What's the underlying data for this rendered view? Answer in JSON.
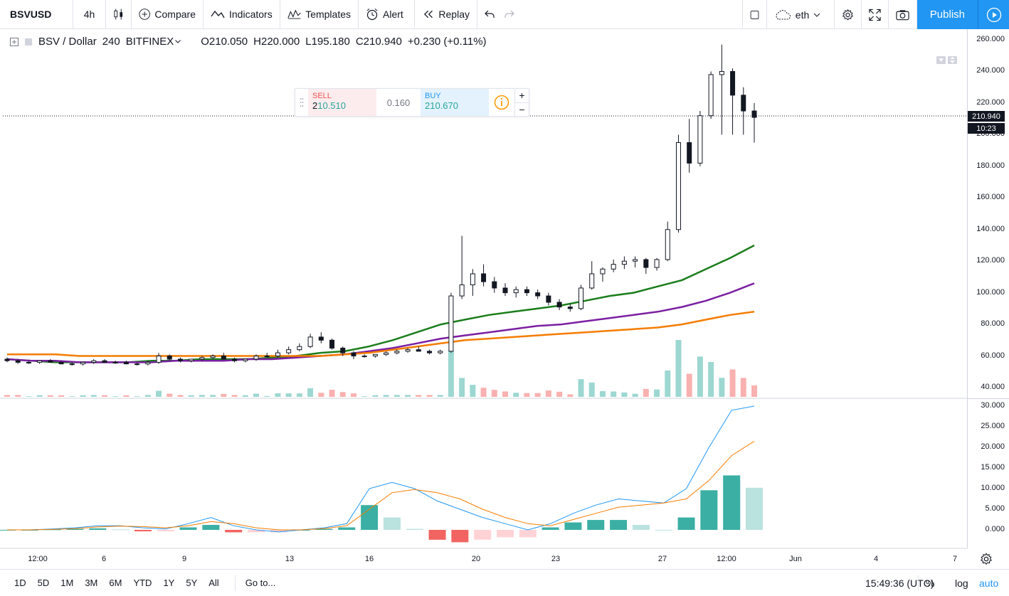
{
  "toolbar": {
    "symbol": "BSVUSD",
    "interval": "4h",
    "compare": "Compare",
    "indicators": "Indicators",
    "templates": "Templates",
    "alert": "Alert",
    "replay": "Replay",
    "layout_name": "eth",
    "publish": "Publish"
  },
  "legend": {
    "title": "BSV / Dollar",
    "interval": "240",
    "exchange": "BITFINEX",
    "open_label": "O",
    "open": "210.050",
    "high_label": "H",
    "high": "220.000",
    "low_label": "L",
    "low": "195.180",
    "close_label": "C",
    "close": "210.940",
    "change": "+0.230 (+0.11%)"
  },
  "trade_panel": {
    "sell_label": "SELL",
    "sell_prefix": "2",
    "sell_price": "10.510",
    "spread": "0.160",
    "buy_label": "BUY",
    "buy_price": "210.670"
  },
  "price_axis": {
    "ticks": [
      "260.000",
      "240.000",
      "220.000",
      "200.000",
      "180.000",
      "160.000",
      "140.000",
      "120.000",
      "100.000",
      "80.000",
      "60.000",
      "40.000"
    ],
    "last_price": "210.940",
    "countdown": "10:23"
  },
  "macd_axis": {
    "ticks": [
      "30.000",
      "25.000",
      "20.000",
      "15.000",
      "10.000",
      "5.000",
      "0.000"
    ]
  },
  "time_axis": {
    "ticks": [
      "12:00",
      "6",
      "9",
      "13",
      "16",
      "20",
      "23",
      "27",
      "12:00",
      "Jun",
      "4",
      "7"
    ]
  },
  "bottom": {
    "ranges": [
      "1D",
      "5D",
      "1M",
      "3M",
      "6M",
      "YTD",
      "1Y",
      "5Y",
      "All"
    ],
    "goto": "Go to...",
    "clock": "15:49:36 (UTC)",
    "percent": "%",
    "log": "log",
    "auto": "auto"
  },
  "colors": {
    "up": "#26a69a",
    "down": "#ef5350",
    "accent": "#2196f3",
    "ma_fast": "#1b7d1b",
    "ma_mid": "#7b1fa2",
    "ma_slow": "#f57c00"
  },
  "chart_data": {
    "type": "candlestick",
    "symbol": "BSV / Dollar",
    "y_range": [
      35,
      265
    ],
    "last_close": 210.94,
    "series": [
      {
        "kind": "ohlc",
        "values": [
          [
            58,
            59,
            56,
            57
          ],
          [
            57,
            58,
            55,
            56
          ],
          [
            56,
            57,
            55,
            56
          ],
          [
            56,
            57,
            55,
            57
          ],
          [
            57,
            58,
            56,
            56
          ],
          [
            56,
            57,
            55,
            55
          ],
          [
            55,
            56,
            54,
            55
          ],
          [
            55,
            56,
            54,
            56
          ],
          [
            56,
            58,
            55,
            57
          ],
          [
            57,
            58,
            56,
            56
          ],
          [
            56,
            57,
            55,
            56
          ],
          [
            56,
            57,
            55,
            55
          ],
          [
            55,
            56,
            54,
            55
          ],
          [
            55,
            57,
            54,
            56
          ],
          [
            56,
            62,
            55,
            60
          ],
          [
            60,
            61,
            57,
            58
          ],
          [
            58,
            59,
            56,
            57
          ],
          [
            57,
            58,
            56,
            58
          ],
          [
            58,
            60,
            57,
            59
          ],
          [
            59,
            61,
            58,
            60
          ],
          [
            60,
            62,
            59,
            58
          ],
          [
            58,
            59,
            56,
            57
          ],
          [
            57,
            58,
            56,
            58
          ],
          [
            58,
            61,
            57,
            60
          ],
          [
            60,
            62,
            59,
            60
          ],
          [
            60,
            64,
            59,
            62
          ],
          [
            62,
            66,
            61,
            64
          ],
          [
            64,
            68,
            63,
            66
          ],
          [
            66,
            74,
            65,
            72
          ],
          [
            72,
            75,
            68,
            70
          ],
          [
            70,
            71,
            64,
            65
          ],
          [
            65,
            66,
            60,
            62
          ],
          [
            62,
            63,
            58,
            60
          ],
          [
            60,
            61,
            59,
            60
          ],
          [
            60,
            61,
            59,
            61
          ],
          [
            61,
            63,
            60,
            62
          ],
          [
            62,
            64,
            61,
            63
          ],
          [
            63,
            65,
            62,
            64
          ],
          [
            64,
            66,
            63,
            63
          ],
          [
            63,
            64,
            61,
            62
          ],
          [
            62,
            64,
            61,
            63
          ],
          [
            63,
            100,
            62,
            98
          ],
          [
            98,
            136,
            96,
            105
          ],
          [
            105,
            115,
            98,
            112
          ],
          [
            112,
            118,
            104,
            107
          ],
          [
            107,
            110,
            100,
            103
          ],
          [
            103,
            106,
            98,
            100
          ],
          [
            100,
            104,
            97,
            102
          ],
          [
            102,
            104,
            98,
            100
          ],
          [
            100,
            102,
            96,
            98
          ],
          [
            98,
            100,
            92,
            94
          ],
          [
            94,
            96,
            89,
            91
          ],
          [
            91,
            93,
            88,
            90
          ],
          [
            90,
            105,
            89,
            103
          ],
          [
            103,
            120,
            102,
            112
          ],
          [
            112,
            116,
            107,
            115
          ],
          [
            115,
            121,
            113,
            118
          ],
          [
            118,
            123,
            115,
            120
          ],
          [
            120,
            123,
            116,
            121
          ],
          [
            121,
            122,
            112,
            116
          ],
          [
            116,
            122,
            114,
            121
          ],
          [
            121,
            145,
            120,
            140
          ],
          [
            140,
            200,
            138,
            195
          ],
          [
            195,
            210,
            176,
            182
          ],
          [
            182,
            215,
            180,
            212
          ],
          [
            212,
            240,
            210,
            238
          ],
          [
            238,
            257,
            200,
            240
          ],
          [
            240,
            242,
            200,
            225
          ],
          [
            225,
            230,
            200,
            215
          ],
          [
            215,
            220,
            195,
            210.94
          ]
        ]
      },
      {
        "kind": "ma",
        "name": "",
        "color": "#1b7d1b",
        "values": [
          58,
          57,
          56,
          56,
          56,
          56,
          57,
          57,
          58,
          58,
          58,
          59,
          60,
          62,
          63,
          66,
          70,
          75,
          80,
          83,
          86,
          88,
          90,
          92,
          95,
          98,
          100,
          104,
          108,
          115,
          122,
          130
        ]
      },
      {
        "kind": "ma",
        "name": "",
        "color": "#7b1fa2",
        "values": [
          58,
          57,
          57,
          56,
          56,
          56,
          56,
          57,
          57,
          57,
          58,
          58,
          59,
          60,
          61,
          63,
          65,
          68,
          71,
          73,
          75,
          77,
          79,
          80,
          82,
          84,
          86,
          88,
          91,
          95,
          100,
          106
        ]
      },
      {
        "kind": "ma",
        "name": "",
        "color": "#f57c00",
        "values": [
          61,
          61,
          61,
          60,
          60,
          60,
          60,
          60,
          60,
          60,
          60,
          60,
          60,
          60,
          61,
          62,
          64,
          66,
          68,
          70,
          71,
          72,
          73,
          74,
          75,
          76,
          77,
          78,
          80,
          83,
          86,
          88
        ]
      }
    ],
    "macd": {
      "y_range": [
        -3,
        31
      ],
      "macd_line": [
        0,
        0,
        0.2,
        0.5,
        1,
        1,
        0.5,
        0.2,
        1.5,
        3,
        1,
        0,
        -0.5,
        0,
        0.5,
        1.5,
        10,
        11.5,
        10,
        7,
        5,
        3,
        1.5,
        0,
        1.5,
        4,
        6,
        7.5,
        7,
        6.5,
        10,
        20,
        29,
        30
      ],
      "signal_line": [
        0,
        0,
        0.1,
        0.3,
        0.7,
        0.9,
        0.8,
        0.5,
        1,
        2,
        1.5,
        0.5,
        0,
        0,
        0.3,
        1,
        5,
        9,
        9.8,
        9,
        7.5,
        5,
        3,
        1.5,
        1,
        2.5,
        4,
        5.5,
        6,
        6.5,
        7.5,
        12,
        18,
        21.5
      ]
    }
  }
}
